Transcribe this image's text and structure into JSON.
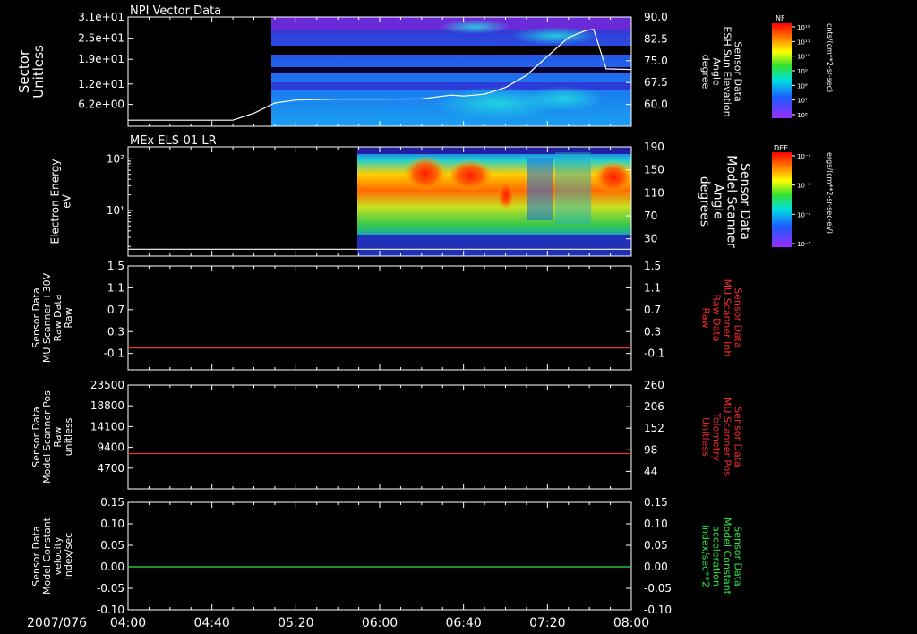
{
  "colors": {
    "background": "#000000",
    "axis": "#ffffff",
    "red_trace": "#e8342c",
    "green_trace": "#2ee84a",
    "red_label": "#ff2a2a",
    "green_label": "#2ee84a"
  },
  "time_axis": {
    "date_label": "2007/076",
    "ticks": [
      "04:00",
      "04:40",
      "05:20",
      "06:00",
      "06:40",
      "07:20",
      "08:00"
    ]
  },
  "colorbars": [
    {
      "title": "NF",
      "unit": "cnts/(cm**2-sr-sec)",
      "tick_labels": [
        "10¹²",
        "10¹¹",
        "10¹⁰",
        "10⁹",
        "10⁸",
        "10⁷",
        "10⁶"
      ],
      "colormap": "rainbow"
    },
    {
      "title": "DEF",
      "unit": "ergs/(cm**2-sr-sec-eV)",
      "tick_labels": [
        "10⁻²",
        "10⁻³",
        "10⁻⁴",
        "10⁻⁵"
      ],
      "colormap": "rainbow"
    }
  ],
  "chart_data": [
    {
      "type": "heatmap",
      "title": "NPI Vector Data",
      "left_axis": {
        "label_lines": [
          "Sector",
          "Unitless"
        ],
        "ticks": [
          "3.1e+01",
          "2.5e+01",
          "1.9e+01",
          "1.2e+01",
          "6.2e+00"
        ],
        "range": [
          0,
          31
        ]
      },
      "right_axis": {
        "label_lines": [
          "Sensor Data",
          "ESH Sun Elevation",
          "Angle",
          "degree"
        ],
        "ticks": [
          "90.0",
          "82.5",
          "75.0",
          "67.5",
          "60.0"
        ],
        "range": [
          52.5,
          90.0
        ]
      },
      "heatmap": {
        "start": "05:10",
        "end": "08:00",
        "colormap": "rainbow"
      },
      "overlay_line": {
        "series": "ESH Sun Elevation Angle",
        "x": [
          "04:00",
          "04:50",
          "05:00",
          "05:10",
          "05:20",
          "05:40",
          "06:00",
          "06:20",
          "06:34",
          "06:40",
          "06:50",
          "07:00",
          "07:10",
          "07:20",
          "07:30",
          "07:38",
          "07:42",
          "07:48",
          "08:00"
        ],
        "y": [
          54.6,
          54.6,
          57.0,
          60.5,
          61.5,
          61.8,
          61.8,
          61.9,
          63.2,
          62.9,
          63.5,
          65.8,
          70.0,
          76.5,
          83.0,
          85.3,
          85.8,
          72.2,
          72.0
        ]
      }
    },
    {
      "type": "heatmap",
      "title": "MEx ELS-01 LR",
      "left_axis": {
        "label_lines": [
          "Electron Energy",
          "eV"
        ],
        "scale": "log",
        "ticks": [
          "10²",
          "10¹"
        ],
        "range": [
          1.3,
          170
        ]
      },
      "right_axis": {
        "label_lines": [
          "Sensor Data",
          "Model Scanner",
          "Angle",
          "degrees"
        ],
        "ticks": [
          "190",
          "150",
          "110",
          "70",
          "30"
        ],
        "range": [
          0,
          190
        ]
      },
      "heatmap": {
        "start": "05:55",
        "end": "08:00",
        "colormap": "rainbow"
      },
      "overlay_line": {
        "series": "Model Scanner Angle",
        "x": [
          "04:00",
          "08:00"
        ],
        "y": [
          12,
          12
        ]
      }
    },
    {
      "type": "line",
      "left_axis": {
        "label_lines": [
          "Sensor Data",
          "MU Scanner +30V",
          "Raw Data",
          "Raw"
        ],
        "ticks": [
          "1.5",
          "1.1",
          "0.7",
          "0.3",
          "-0.1"
        ],
        "range": [
          -0.4,
          1.5
        ]
      },
      "right_axis": {
        "label_lines": [
          "Sensor Data",
          "MU Scanner Inh",
          "Raw Data",
          "Raw"
        ],
        "ticks": [
          "1.5",
          "1.1",
          "0.7",
          "0.3",
          "-0.1"
        ],
        "range": [
          -0.4,
          1.5
        ],
        "label_color": "red"
      },
      "series": [
        {
          "color": "red",
          "x": [
            "04:00",
            "08:00"
          ],
          "y": [
            0.0,
            0.0
          ]
        }
      ]
    },
    {
      "type": "line",
      "left_axis": {
        "label_lines": [
          "Sensor Data",
          "Model Scanner Pos",
          "Raw",
          "unitless"
        ],
        "ticks": [
          "23500",
          "18800",
          "14100",
          "9400",
          "4700"
        ],
        "range": [
          0,
          23500
        ]
      },
      "right_axis": {
        "label_lines": [
          "Sensor Data",
          "MU Scanner Pos",
          "Telemetry",
          "Unitless"
        ],
        "ticks": [
          "260",
          "206",
          "152",
          "98",
          "44"
        ],
        "range": [
          0,
          260
        ],
        "label_color": "red"
      },
      "series": [
        {
          "color": "red",
          "x": [
            "04:00",
            "08:00"
          ],
          "y": [
            8000,
            8000
          ]
        }
      ]
    },
    {
      "type": "line",
      "left_axis": {
        "label_lines": [
          "Sensor Data",
          "Model Constant",
          "velocity",
          "index/sec"
        ],
        "ticks": [
          "0.15",
          "0.10",
          "0.05",
          "0.00",
          "-0.05",
          "-0.10"
        ],
        "range": [
          -0.1,
          0.15
        ]
      },
      "right_axis": {
        "label_lines": [
          "Sensor Data",
          "Model Constant",
          "acceleration",
          "index/sec**2"
        ],
        "ticks": [
          "0.15",
          "0.10",
          "0.05",
          "0.00",
          "-0.05",
          "-0.10"
        ],
        "range": [
          -0.1,
          0.15
        ],
        "label_color": "green"
      },
      "series": [
        {
          "color": "green",
          "x": [
            "04:00",
            "08:00"
          ],
          "y": [
            0.0,
            0.0
          ]
        }
      ]
    }
  ]
}
